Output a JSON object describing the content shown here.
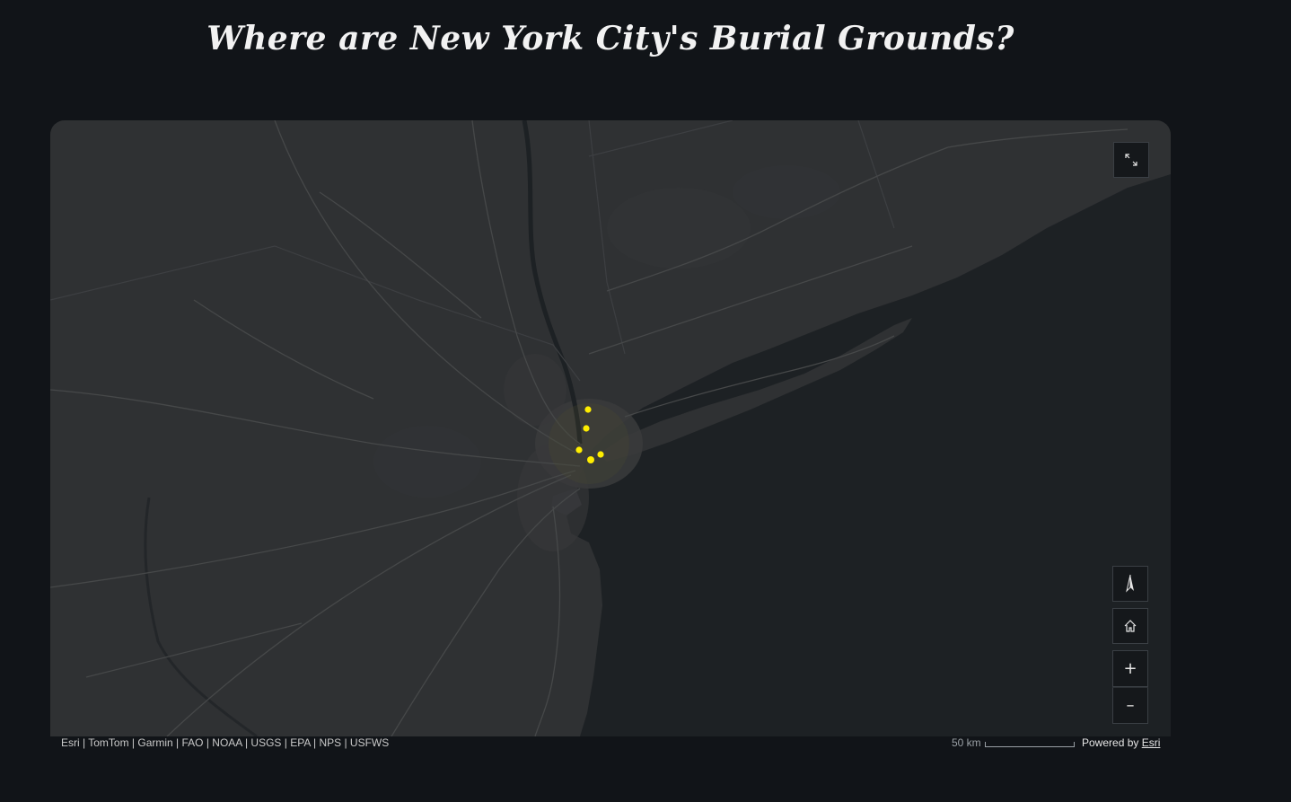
{
  "page": {
    "title": "Where are New York City's Burial Grounds?"
  },
  "map": {
    "basemap_style": "dark-gray-canvas",
    "colors": {
      "water": "#1d2124",
      "land": "#2f3133",
      "urban": "#3a3b3c",
      "roads": "#464849",
      "marker": "#ffee00"
    },
    "controls": {
      "fullscreen_icon": "expand-icon",
      "compass_icon": "compass-icon",
      "home_icon": "home-icon",
      "zoom_in_label": "+",
      "zoom_out_label": "–"
    },
    "markers_count": 5
  },
  "footer": {
    "attribution": "Esri | TomTom | Garmin | FAO | NOAA | USGS | EPA | NPS | USFWS",
    "scale_label": "50 km",
    "powered_by": "Powered by",
    "esri_link": "Esri"
  }
}
